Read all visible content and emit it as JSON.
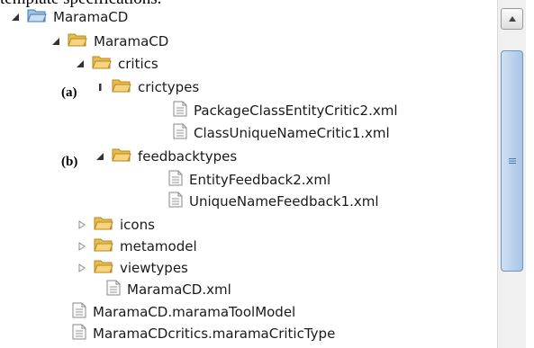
{
  "caption_fragment": "template specifications.",
  "tree": [
    {
      "label": "MaramaCD",
      "type": "project",
      "state": "expanded"
    },
    {
      "label": "MaramaCD",
      "type": "folder",
      "state": "expanded"
    },
    {
      "label": "critics",
      "type": "folder",
      "state": "expanded"
    },
    {
      "label": "crictypes",
      "type": "folder",
      "state": "expanded"
    },
    {
      "label": "PackageClassEntityCritic2.xml",
      "type": "file"
    },
    {
      "label": "ClassUniqueNameCritic1.xml",
      "type": "file"
    },
    {
      "label": "feedbacktypes",
      "type": "folder",
      "state": "expanded"
    },
    {
      "label": "EntityFeedback2.xml",
      "type": "file"
    },
    {
      "label": "UniqueNameFeedback1.xml",
      "type": "file"
    },
    {
      "label": "icons",
      "type": "folder",
      "state": "collapsed"
    },
    {
      "label": "metamodel",
      "type": "folder",
      "state": "collapsed"
    },
    {
      "label": "viewtypes",
      "type": "folder",
      "state": "collapsed"
    },
    {
      "label": "MaramaCD.xml",
      "type": "file"
    },
    {
      "label": "MaramaCD.maramaToolModel",
      "type": "file"
    },
    {
      "label": "MaramaCDcritics.maramaCriticType",
      "type": "file"
    }
  ],
  "annotations": {
    "a": "(a)",
    "b": "(b)"
  },
  "colors": {
    "folder_fill": "#f6d37e",
    "folder_edge": "#b58a1e",
    "project_fill": "#9cc3e8",
    "file_edge": "#8a8a8a"
  }
}
